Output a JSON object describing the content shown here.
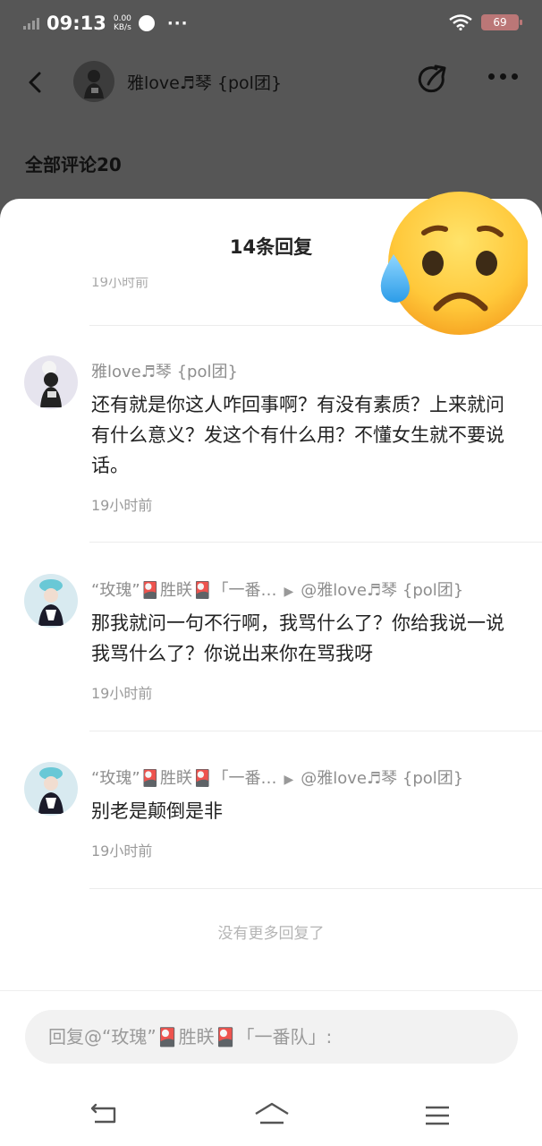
{
  "status_bar": {
    "time": "09:13",
    "net_speed_value": "0.00",
    "net_speed_unit": "KB/s",
    "more": "···",
    "battery": "69"
  },
  "nav": {
    "title": "雅love♬琴 {pol团}"
  },
  "page": {
    "all_comments_label": "全部评论20"
  },
  "sheet": {
    "title": "14条回复",
    "clipped_time": "19小时前",
    "replies": [
      {
        "author": "雅love♬琴 {pol团}",
        "reply_to": "",
        "text": "还有就是你这人咋回事啊？有没有素质？上来就问有什么意义？发这个有什么用？不懂女生就不要说话。",
        "time": "19小时前"
      },
      {
        "author": "“玫瑰”🎴胜眹🎴「一番…",
        "reply_to": "@雅love♬琴 {pol团}",
        "text": "那我就问一句不行啊，我骂什么了？你给我说一说我骂什么了？你说出来你在骂我呀",
        "time": "19小时前"
      },
      {
        "author": "“玫瑰”🎴胜眹🎴「一番…",
        "reply_to": "@雅love♬琴 {pol团}",
        "text": "别老是颠倒是非",
        "time": "19小时前"
      }
    ],
    "arrow": "▶",
    "no_more": "没有更多回复了",
    "input_placeholder": "回复@“玫瑰”🎴胜眹🎴「一番队」:"
  },
  "icons": {
    "back": "back-arrow-icon",
    "share": "share-icon",
    "more": "more-dots-icon",
    "emoji": "sad-sweat-emoji",
    "sys_back": "system-back-icon",
    "sys_home": "system-home-icon",
    "sys_menu": "system-menu-icon"
  },
  "colors": {
    "overlay": "#565656",
    "sheet": "#ffffff",
    "input_bg": "#f2f2f2",
    "battery": "#bb7777"
  }
}
